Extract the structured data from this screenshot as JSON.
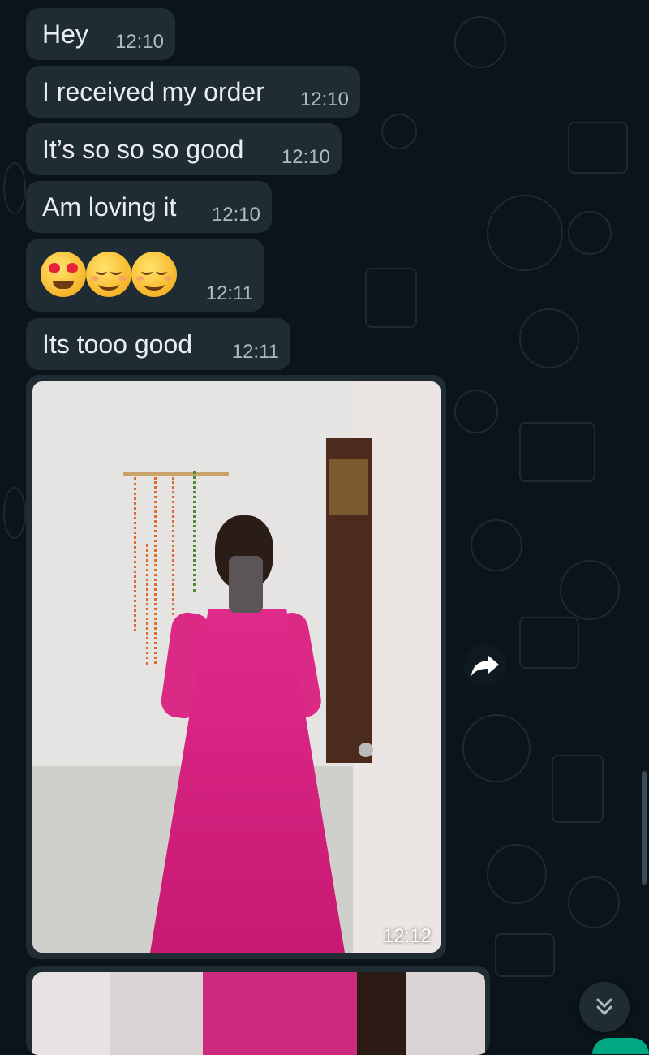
{
  "messages": [
    {
      "text": "Hey",
      "time": "12:10"
    },
    {
      "text": "I received my order",
      "time": "12:10"
    },
    {
      "text": "It’s so so so good",
      "time": "12:10"
    },
    {
      "text": "Am loving it",
      "time": "12:10"
    },
    {
      "emojis": [
        "smiling-face-with-heart-eyes",
        "relieved-face",
        "relieved-face"
      ],
      "time": "12:11"
    },
    {
      "text": "Its tooo good",
      "time": "12:11"
    }
  ],
  "media_message": {
    "time": "12:12"
  },
  "icons": {
    "forward": "forward-arrow-icon",
    "scroll_down": "double-chevron-down-icon"
  },
  "colors": {
    "background": "#0b141a",
    "bubble": "#1f2c34",
    "text": "#e9edef",
    "timestamp": "#aebac1",
    "accent": "#00a884"
  }
}
